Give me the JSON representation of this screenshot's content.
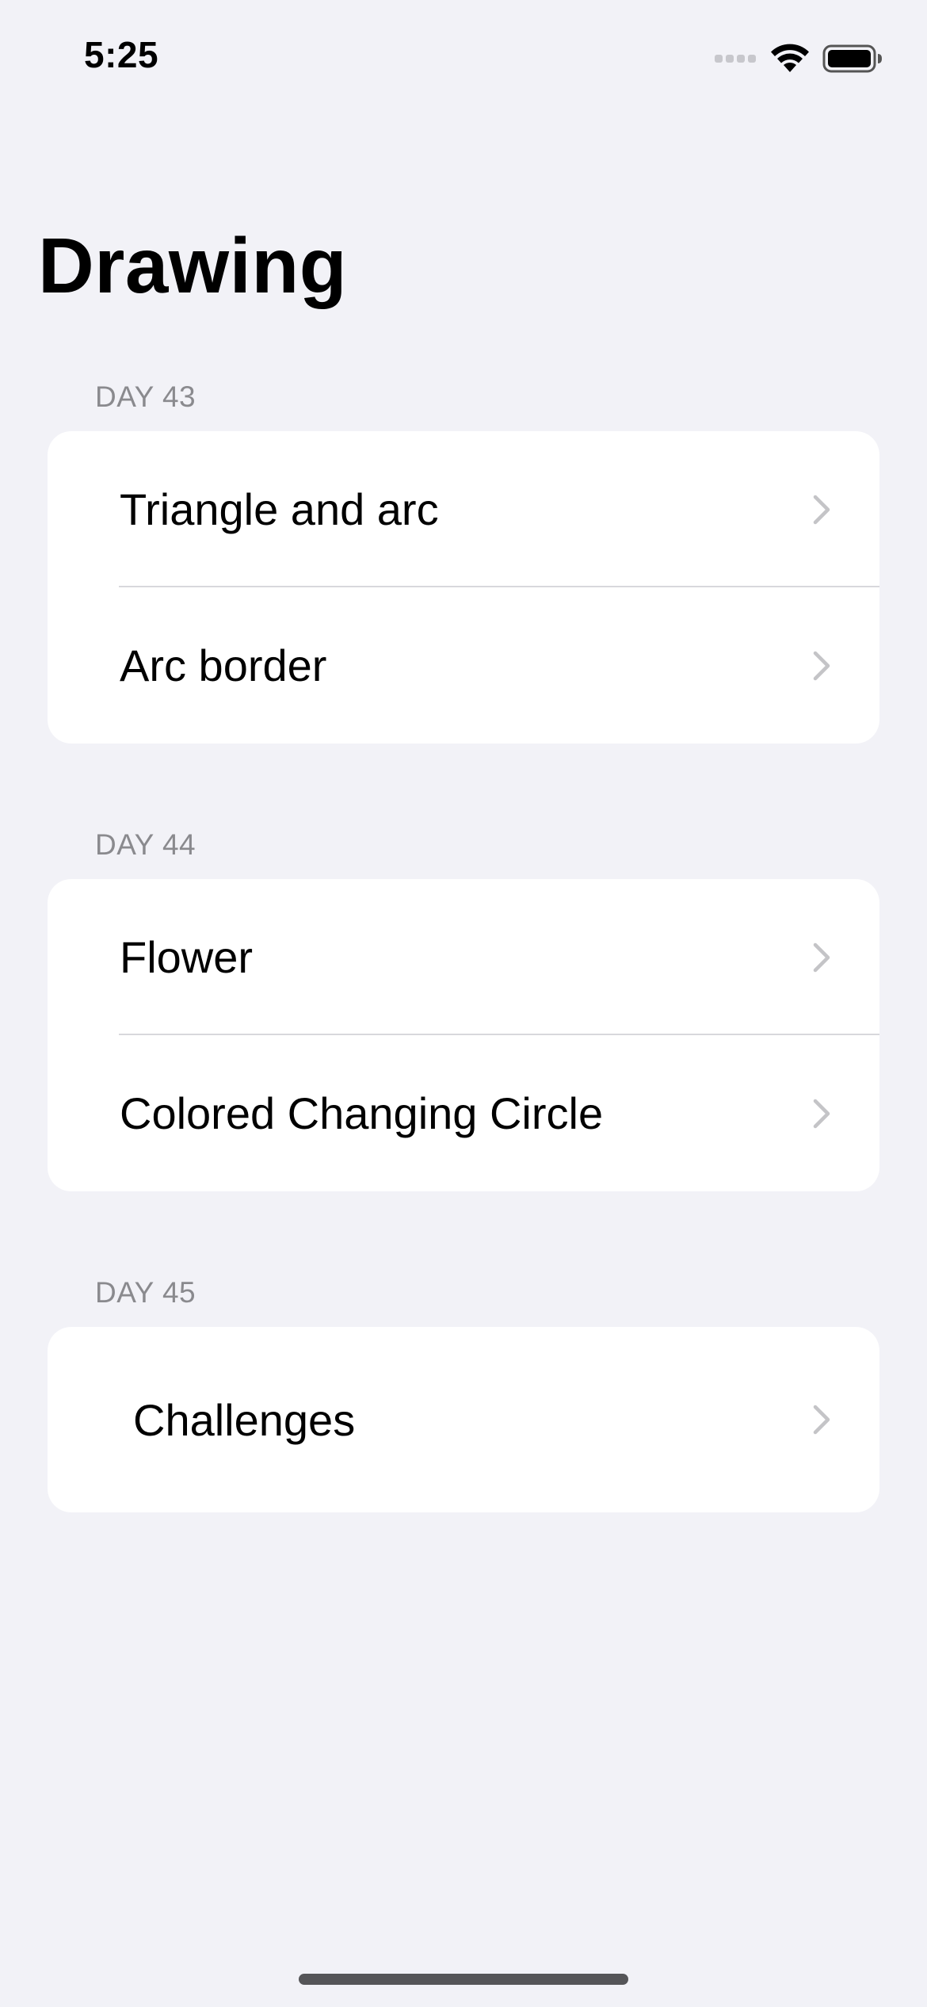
{
  "status_bar": {
    "time": "5:25",
    "icons": [
      "signal-icon",
      "wifi-icon",
      "battery-icon"
    ]
  },
  "nav": {
    "title": "Drawing"
  },
  "sections": [
    {
      "header": "DAY 43",
      "rows": [
        {
          "label": "Triangle and arc"
        },
        {
          "label": "Arc border"
        }
      ]
    },
    {
      "header": "DAY 44",
      "rows": [
        {
          "label": "Flower"
        },
        {
          "label": "Colored Changing Circle"
        }
      ]
    },
    {
      "header": "DAY 45",
      "rows": [
        {
          "label": "Challenges"
        }
      ]
    }
  ],
  "colors": {
    "background": "#F2F2F7",
    "cell": "#FFFFFF",
    "secondary_text": "#8A8A8E",
    "chevron": "#C4C4C7",
    "separator": "#D8D8DC"
  }
}
